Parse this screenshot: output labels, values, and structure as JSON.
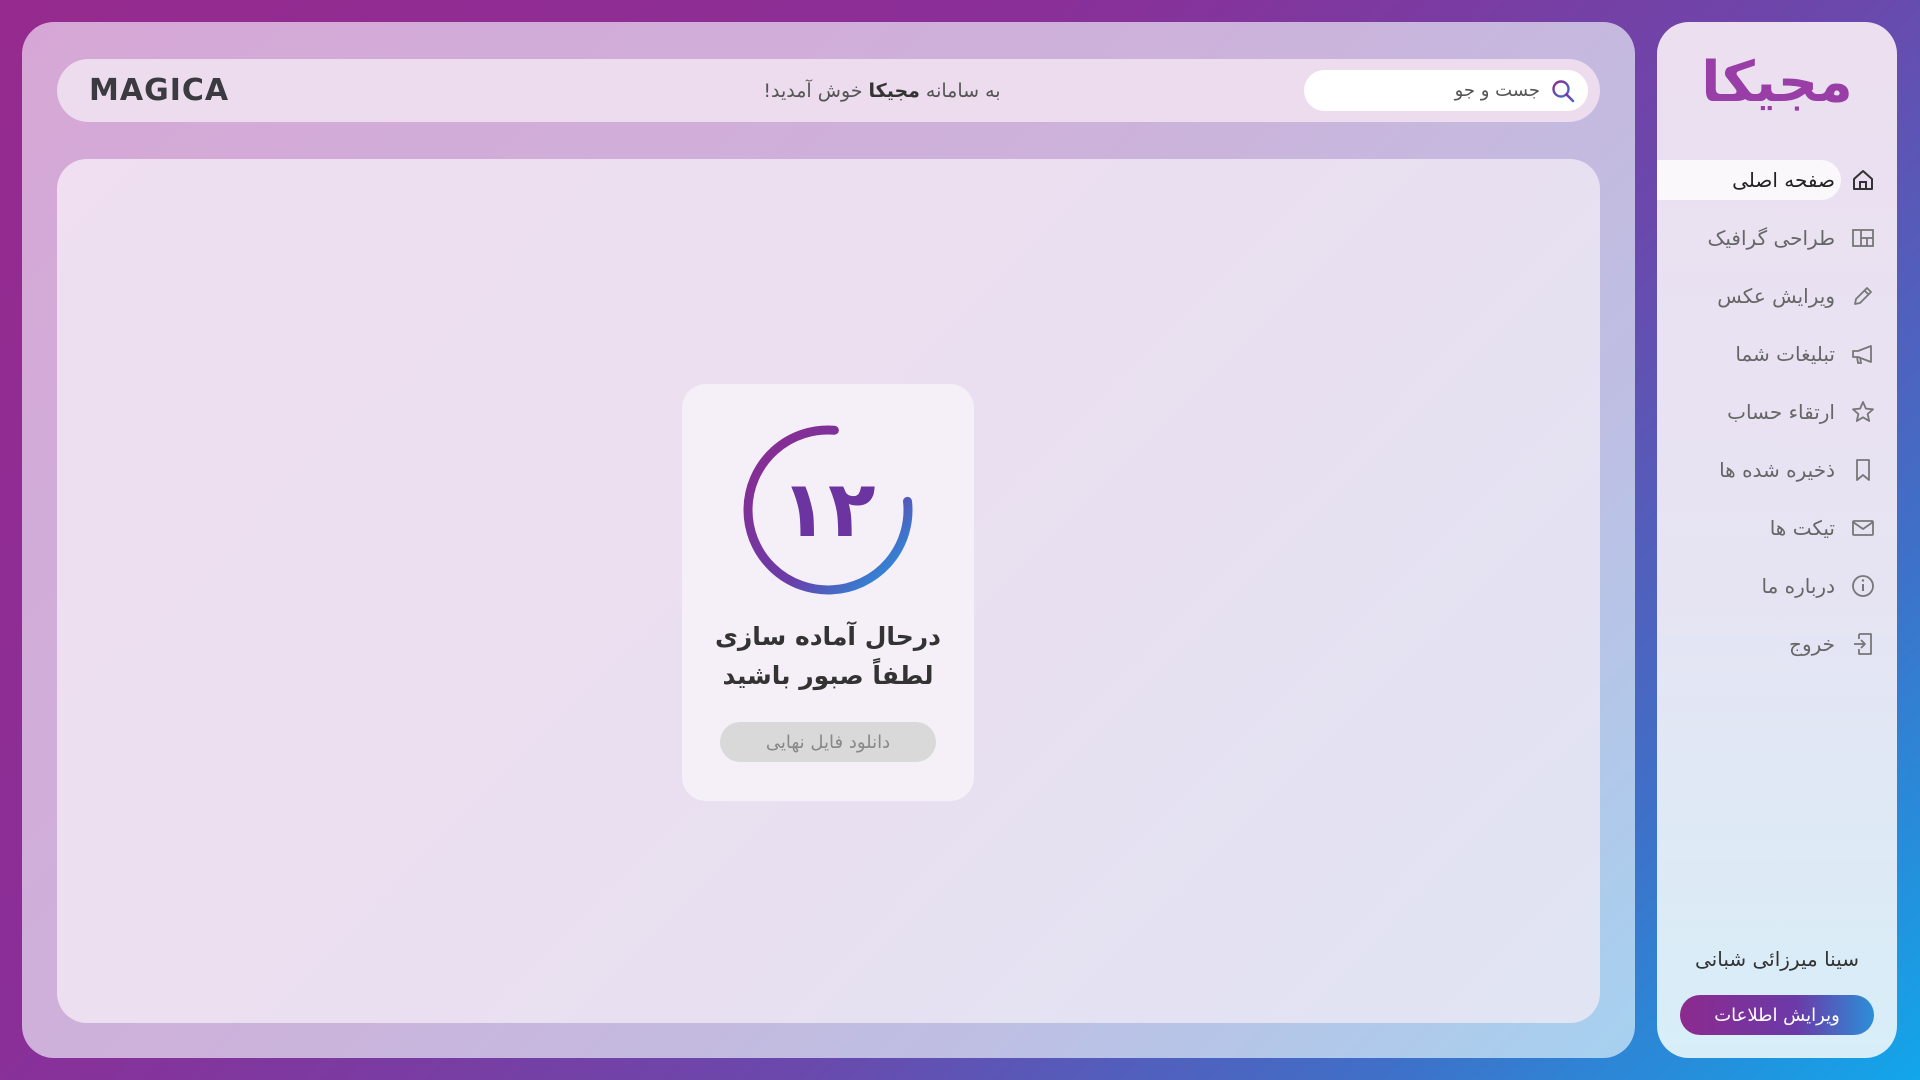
{
  "header": {
    "logo_text": "MAGICA",
    "welcome_prefix": "به سامانه",
    "welcome_brand": "مجیکا",
    "welcome_suffix": "خوش آمدید!",
    "search": {
      "placeholder": "جست و جو",
      "icon": "search-icon"
    }
  },
  "progress": {
    "count": "۱۲",
    "line1": "درحال آماده سازی",
    "line2": "لطفاً صبور باشید",
    "download_label": "دانلود فایل نهایی",
    "ring_fraction": 0.78
  },
  "sidebar": {
    "brand": "مجیکا",
    "items": [
      {
        "label": "صفحه اصلی",
        "icon": "home-icon",
        "active": true
      },
      {
        "label": "طراحی گرافیک",
        "icon": "layout-icon",
        "active": false
      },
      {
        "label": "ویرایش عکس",
        "icon": "pencil-icon",
        "active": false
      },
      {
        "label": "تبلیغات شما",
        "icon": "megaphone-icon",
        "active": false
      },
      {
        "label": "ارتقاء حساب",
        "icon": "star-icon",
        "active": false
      },
      {
        "label": "ذخیره شده ها",
        "icon": "bookmark-icon",
        "active": false
      },
      {
        "label": "تیکت ها",
        "icon": "mail-icon",
        "active": false
      },
      {
        "label": "درباره ما",
        "icon": "info-icon",
        "active": false
      },
      {
        "label": "خروج",
        "icon": "logout-icon",
        "active": false
      }
    ],
    "user_name": "سینا میرزائی شبانی",
    "edit_label": "ویرایش اطلاعات"
  },
  "colors": {
    "accent_purple": "#8d2a8e",
    "accent_blue": "#12a6ea",
    "ring_start": "#8d2a8e",
    "ring_end": "#1aa3e8"
  }
}
